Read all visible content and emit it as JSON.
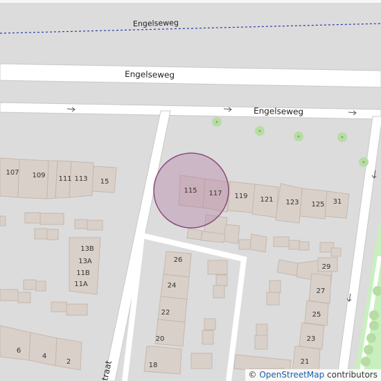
{
  "map": {
    "streets": {
      "top_dotted": "Engelseweg",
      "middle": "Engelseweg",
      "upper_road": "Engelseweg",
      "vertical_partial": "traat"
    },
    "house_numbers": {
      "n107": "107",
      "n109": "109",
      "n111": "111",
      "n113": "113",
      "n15": "15",
      "n115": "115",
      "n117": "117",
      "n119": "119",
      "n121": "121",
      "n123": "123",
      "n125": "125",
      "n31": "31",
      "n13B": "13B",
      "n13A": "13A",
      "n11B": "11B",
      "n11A": "11A",
      "n26": "26",
      "n24": "24",
      "n22": "22",
      "n20": "20",
      "n18": "18",
      "n29": "29",
      "n27": "27",
      "n25": "25",
      "n23": "23",
      "n21": "21",
      "n6": "6",
      "n4": "4",
      "n2": "2"
    },
    "marker_color": "#b37fa6"
  },
  "attribution": {
    "copyright_symbol": "©",
    "link_text": "OpenStreetMap",
    "suffix": "contributors"
  }
}
